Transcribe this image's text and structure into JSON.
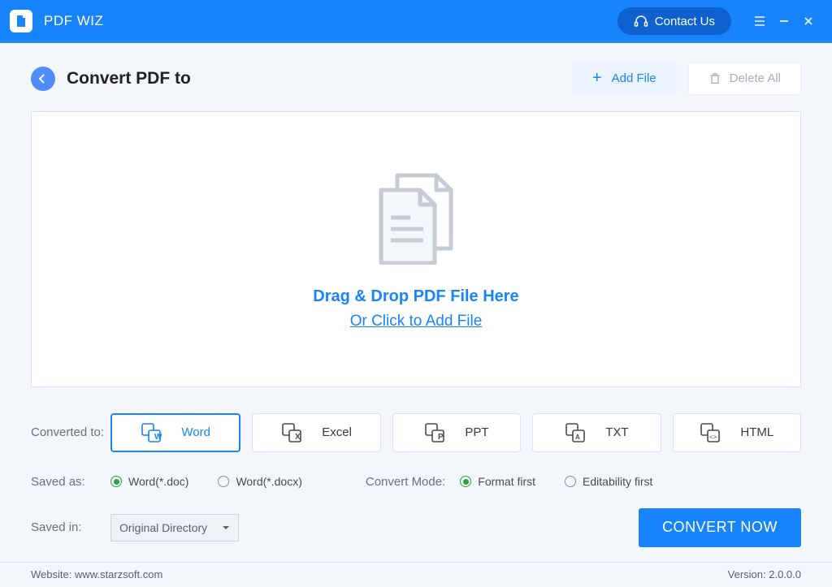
{
  "titlebar": {
    "app_name": "PDF WIZ",
    "contact_label": "Contact Us"
  },
  "header": {
    "page_title": "Convert PDF to",
    "add_file_label": "Add File",
    "delete_all_label": "Delete All"
  },
  "dropzone": {
    "line1": "Drag & Drop PDF File Here",
    "line2": "Or Click to Add File"
  },
  "convert_to": {
    "label": "Converted to:",
    "options": [
      {
        "label": "Word",
        "selected": true
      },
      {
        "label": "Excel",
        "selected": false
      },
      {
        "label": "PPT",
        "selected": false
      },
      {
        "label": "TXT",
        "selected": false
      },
      {
        "label": "HTML",
        "selected": false
      }
    ]
  },
  "saved_as": {
    "label": "Saved as:",
    "options": [
      {
        "label": "Word(*.doc)",
        "checked": true
      },
      {
        "label": "Word(*.docx)",
        "checked": false
      }
    ]
  },
  "convert_mode": {
    "label": "Convert Mode:",
    "options": [
      {
        "label": "Format first",
        "checked": true
      },
      {
        "label": "Editability first",
        "checked": false
      }
    ]
  },
  "saved_in": {
    "label": "Saved in:",
    "selected": "Original Directory"
  },
  "convert_button": "CONVERT NOW",
  "footer": {
    "website_label": "Website: www.starzsoft.com",
    "version_label": "Version: 2.0.0.0"
  },
  "colors": {
    "primary": "#1784fc"
  }
}
